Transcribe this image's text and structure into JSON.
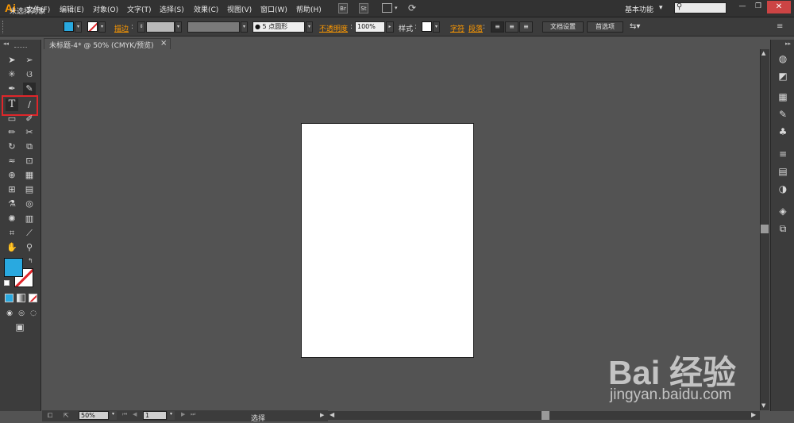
{
  "app": {
    "logo": "Ai"
  },
  "menu": [
    "文件(F)",
    "编辑(E)",
    "对象(O)",
    "文字(T)",
    "选择(S)",
    "效果(C)",
    "视图(V)",
    "窗口(W)",
    "帮助(H)"
  ],
  "menu_icons": {
    "br": "Br",
    "st": "St"
  },
  "workspace": {
    "label": "基本功能",
    "arrow": "▾"
  },
  "search": {
    "placeholder": ""
  },
  "window_controls": {
    "minimize": "—",
    "restore": "❐",
    "close": "✕"
  },
  "control_bar": {
    "selection_status": "未选择对象",
    "stroke_label": "描边",
    "stroke_value": "",
    "brush_value": "5 点圆形",
    "opacity_label": "不透明度",
    "opacity_value": "100%",
    "style_label": "样式",
    "char_label": "字符",
    "para_label": "段落",
    "doc_setup": "文档设置",
    "prefs": "首选项"
  },
  "document": {
    "tab_title": "未标题-4* @ 50% (CMYK/预览)",
    "tab_close": "×"
  },
  "status_bar": {
    "zoom": "50%",
    "page": "1",
    "status_text": "选择"
  },
  "colors": {
    "fill": "#29a9e0",
    "accent_orange": "#ff9a00",
    "highlight_red": "#e0262a"
  },
  "watermark": {
    "logo": "Bai 经验",
    "url": "jingyan.baidu.com"
  }
}
